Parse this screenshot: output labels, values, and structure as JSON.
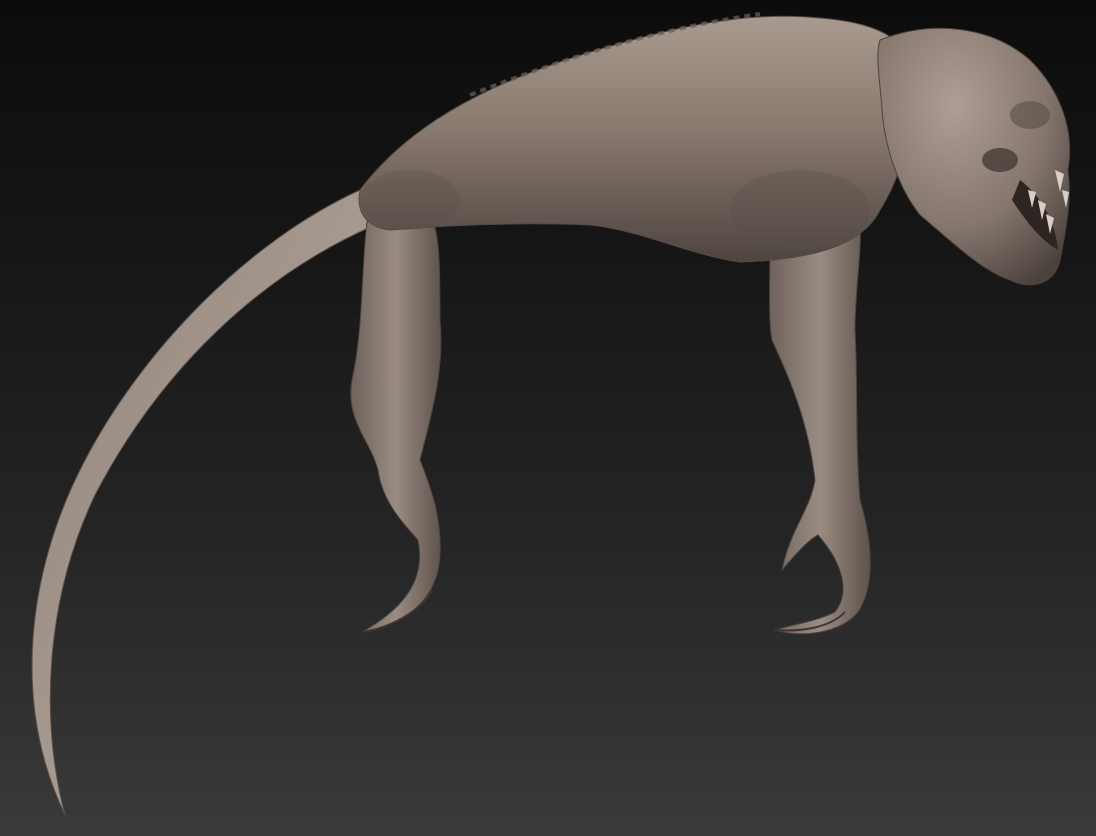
{
  "scene": {
    "subject": "sculpted-creature",
    "background_top": "#0c0c0c",
    "background_bottom": "#3a3a3a",
    "skin_color": "#8c7c72",
    "skin_highlight": "#b3a498",
    "skin_shadow": "#4a3f3a"
  }
}
